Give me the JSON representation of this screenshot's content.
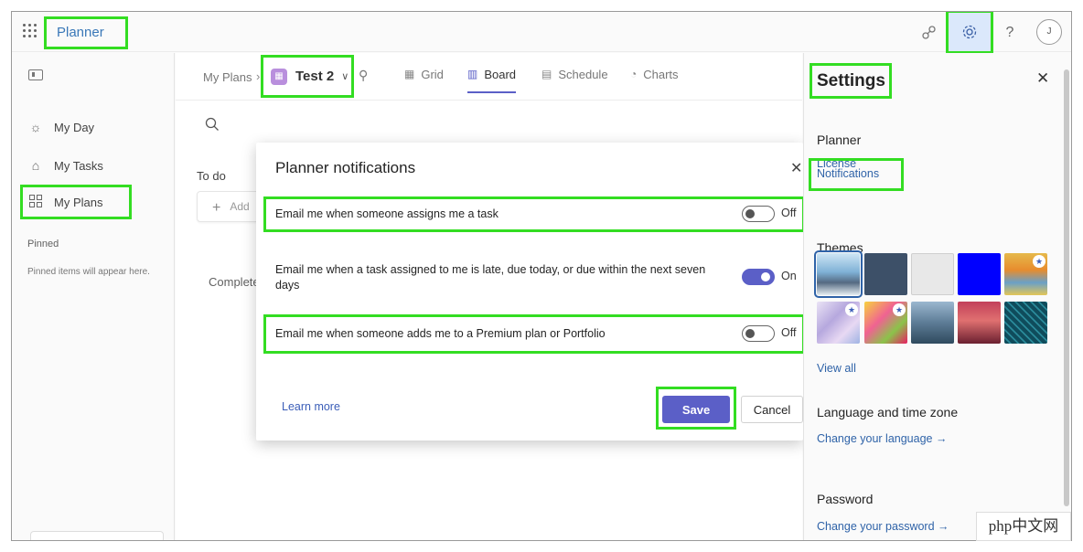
{
  "app": {
    "title": "Planner",
    "avatar_initial": "J"
  },
  "leftnav": {
    "items": [
      {
        "label": "My Day",
        "icon": "sun-icon"
      },
      {
        "label": "My Tasks",
        "icon": "home-task-icon"
      },
      {
        "label": "My Plans",
        "icon": "grid-plans-icon"
      }
    ],
    "pinned_heading": "Pinned",
    "pinned_empty": "Pinned items will appear here."
  },
  "header": {
    "breadcrumb_root": "My Plans",
    "plan_name": "Test 2",
    "tabs": [
      {
        "label": "Grid",
        "icon": "grid-icon"
      },
      {
        "label": "Board",
        "icon": "board-icon",
        "active": true
      },
      {
        "label": "Schedule",
        "icon": "calendar-icon"
      },
      {
        "label": "Charts",
        "icon": "chart-icon"
      }
    ]
  },
  "board": {
    "bucket": "To do",
    "add_task": "Add",
    "completed": "Complete"
  },
  "modal": {
    "title": "Planner notifications",
    "rows": [
      {
        "text": "Email me when someone assigns me a task",
        "state": "Off"
      },
      {
        "text": "Email me when a task assigned to me is late, due today, or due within the next seven days",
        "state": "On"
      },
      {
        "text": "Email me when someone adds me to a Premium plan or Portfolio",
        "state": "Off"
      }
    ],
    "learn_more": "Learn more",
    "save": "Save",
    "cancel": "Cancel"
  },
  "settings": {
    "title": "Settings",
    "planner_heading": "Planner",
    "license_link": "License",
    "notifications_link": "Notifications",
    "themes_heading": "Themes",
    "view_all": "View all",
    "language_heading": "Language and time zone",
    "language_link": "Change your language →",
    "password_heading": "Password",
    "password_link": "Change your password →"
  },
  "watermark": "php中文网",
  "colors": {
    "accent": "#5b5fc7",
    "highlight": "#33dd22",
    "link": "#2f63a8"
  }
}
